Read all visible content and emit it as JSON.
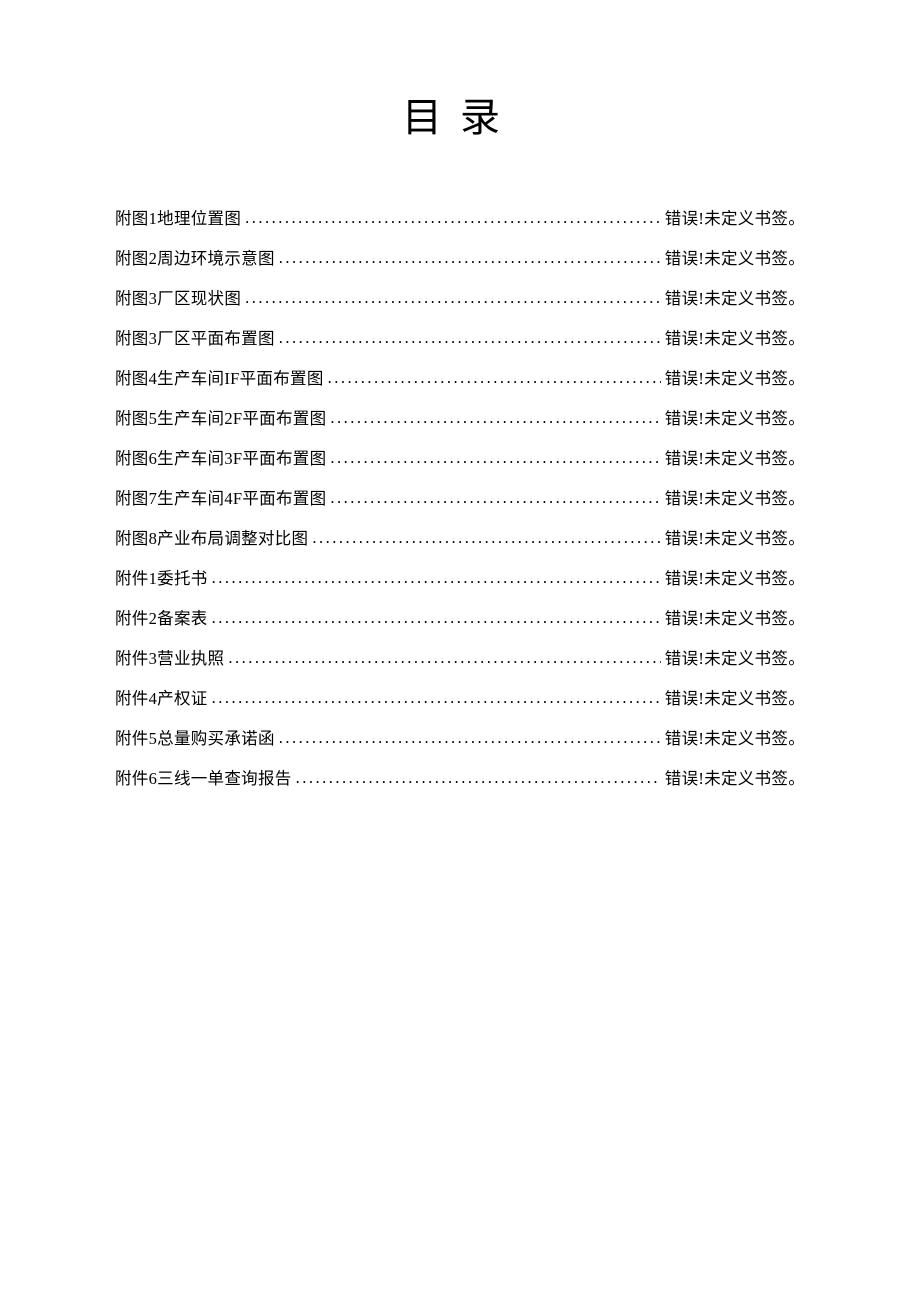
{
  "title": "目录",
  "entries": [
    {
      "label": "附图1地理位置图",
      "page": "错误!未定义书签。"
    },
    {
      "label": "附图2周边环境示意图",
      "page": "错误!未定义书签。"
    },
    {
      "label": "附图3厂区现状图",
      "page": "错误!未定义书签。"
    },
    {
      "label": "附图3厂区平面布置图",
      "page": "错误!未定义书签。"
    },
    {
      "label": "附图4生产车间IF平面布置图",
      "page": "错误!未定义书签。"
    },
    {
      "label": "附图5生产车间2F平面布置图",
      "page": "错误!未定义书签。"
    },
    {
      "label": "附图6生产车间3F平面布置图",
      "page": "错误!未定义书签。"
    },
    {
      "label": "附图7生产车间4F平面布置图",
      "page": "错误!未定义书签。"
    },
    {
      "label": "附图8产业布局调整对比图",
      "page": "错误!未定义书签。"
    },
    {
      "label": "附件1委托书",
      "page": "错误!未定义书签。"
    },
    {
      "label": "附件2备案表",
      "page": "错误!未定义书签。"
    },
    {
      "label": "附件3营业执照",
      "page": "错误!未定义书签。"
    },
    {
      "label": "附件4产权证",
      "page": "错误!未定义书签。"
    },
    {
      "label": "附件5总量购买承诺函",
      "page": "错误!未定义书签。"
    },
    {
      "label": "附件6三线一单查询报告",
      "page": "错误!未定义书签。"
    }
  ]
}
